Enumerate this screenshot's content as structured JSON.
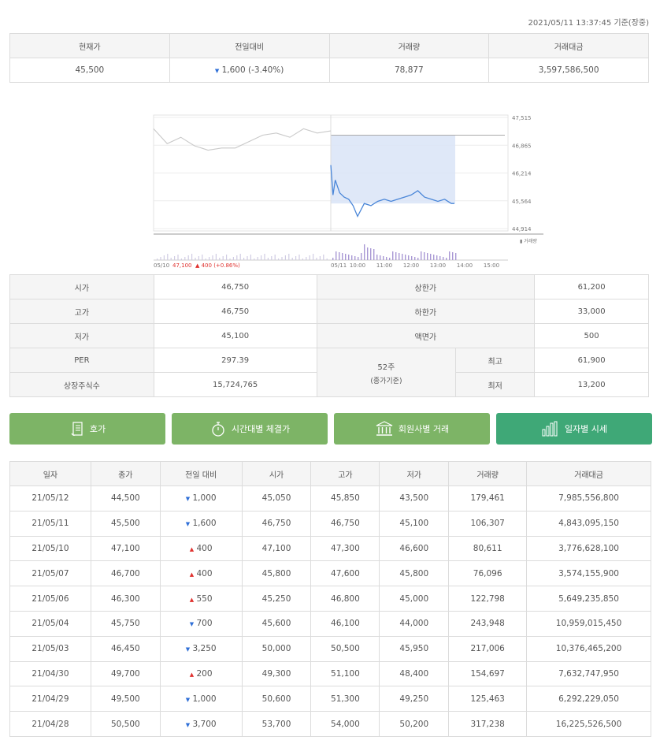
{
  "timestamp": "2021/05/11 13:37:45 기준(장중)",
  "summary": {
    "headers": [
      "현재가",
      "전일대비",
      "거래량",
      "거래대금"
    ],
    "price": "45,500",
    "change_dir": "down",
    "change": "1,600 (-3.40%)",
    "volume": "78,877",
    "amount": "3,597,586,500"
  },
  "chart_data": {
    "type": "line",
    "y_ticks": [
      "47,515",
      "46,865",
      "46,214",
      "45,564",
      "44,914"
    ],
    "ylim": [
      44914,
      47515
    ],
    "volume_legend": "거래량",
    "prev_day_label": "05/10",
    "prev_close_note": "47,100",
    "prev_change_note": "400 (+0.86%)",
    "x_ticks": [
      "05/11",
      "10:00",
      "11:00",
      "12:00",
      "13:00",
      "14:00",
      "15:00"
    ],
    "prev_day_close": 47100,
    "series": [
      {
        "x": [
          "09:00",
          "09:30",
          "10:00",
          "10:30",
          "11:00",
          "11:30",
          "12:00",
          "12:30",
          "13:00",
          "13:30",
          "14:00",
          "14:30",
          "15:00",
          "15:30"
        ],
        "values": [
          47250,
          46900,
          47050,
          46850,
          46750,
          46800,
          46800,
          46950,
          47100,
          47150,
          47050,
          47250,
          47150,
          47200
        ]
      },
      {
        "x": [
          "09:00",
          "09:05",
          "09:10",
          "09:20",
          "09:30",
          "09:40",
          "09:50",
          "10:00",
          "10:15",
          "10:30",
          "10:45",
          "11:00",
          "11:15",
          "11:30",
          "11:45",
          "12:00",
          "12:15",
          "12:30",
          "12:45",
          "13:00",
          "13:15",
          "13:30",
          "13:37"
        ],
        "values": [
          46400,
          45700,
          46050,
          45750,
          45650,
          45600,
          45450,
          45200,
          45500,
          45450,
          45550,
          45600,
          45550,
          45600,
          45650,
          45700,
          45800,
          45650,
          45600,
          45550,
          45600,
          45500,
          45500
        ]
      }
    ]
  },
  "info": {
    "open_label": "시가",
    "open": "46,750",
    "upper_label": "상한가",
    "upper": "61,200",
    "high_label": "고가",
    "high": "46,750",
    "lower_label": "하한가",
    "lower": "33,000",
    "low_label": "저가",
    "low": "45,100",
    "par_label": "액면가",
    "par": "500",
    "per_label": "PER",
    "per": "297.39",
    "week52_label": "52주",
    "week52_sub": "(종가기준)",
    "w52_high_label": "최고",
    "w52_high": "61,900",
    "shares_label": "상장주식수",
    "shares": "15,724,765",
    "w52_low_label": "최저",
    "w52_low": "13,200"
  },
  "buttons": {
    "hoga": "호가",
    "time": "시간대별 체결가",
    "member": "회원사별 거래",
    "daily": "일자별 시세"
  },
  "daily": {
    "headers": [
      "일자",
      "종가",
      "전일 대비",
      "시가",
      "고가",
      "저가",
      "거래량",
      "거래대금"
    ],
    "rows": [
      {
        "date": "21/05/12",
        "close": "44,500",
        "dir": "down",
        "diff": "1,000",
        "open": "45,050",
        "high": "45,850",
        "low": "43,500",
        "vol": "179,461",
        "amt": "7,985,556,800"
      },
      {
        "date": "21/05/11",
        "close": "45,500",
        "dir": "down",
        "diff": "1,600",
        "open": "46,750",
        "high": "46,750",
        "low": "45,100",
        "vol": "106,307",
        "amt": "4,843,095,150"
      },
      {
        "date": "21/05/10",
        "close": "47,100",
        "dir": "up",
        "diff": "400",
        "open": "47,100",
        "high": "47,300",
        "low": "46,600",
        "vol": "80,611",
        "amt": "3,776,628,100"
      },
      {
        "date": "21/05/07",
        "close": "46,700",
        "dir": "up",
        "diff": "400",
        "open": "45,800",
        "high": "47,600",
        "low": "45,800",
        "vol": "76,096",
        "amt": "3,574,155,900"
      },
      {
        "date": "21/05/06",
        "close": "46,300",
        "dir": "up",
        "diff": "550",
        "open": "45,250",
        "high": "46,800",
        "low": "45,000",
        "vol": "122,798",
        "amt": "5,649,235,850"
      },
      {
        "date": "21/05/04",
        "close": "45,750",
        "dir": "down",
        "diff": "700",
        "open": "45,600",
        "high": "46,100",
        "low": "44,000",
        "vol": "243,948",
        "amt": "10,959,015,450"
      },
      {
        "date": "21/05/03",
        "close": "46,450",
        "dir": "down",
        "diff": "3,250",
        "open": "50,000",
        "high": "50,500",
        "low": "45,950",
        "vol": "217,006",
        "amt": "10,376,465,200"
      },
      {
        "date": "21/04/30",
        "close": "49,700",
        "dir": "up",
        "diff": "200",
        "open": "49,300",
        "high": "51,100",
        "low": "48,400",
        "vol": "154,697",
        "amt": "7,632,747,950"
      },
      {
        "date": "21/04/29",
        "close": "49,500",
        "dir": "down",
        "diff": "1,000",
        "open": "50,600",
        "high": "51,300",
        "low": "49,250",
        "vol": "125,463",
        "amt": "6,292,229,050"
      },
      {
        "date": "21/04/28",
        "close": "50,500",
        "dir": "down",
        "diff": "3,700",
        "open": "53,700",
        "high": "54,000",
        "low": "50,200",
        "vol": "317,238",
        "amt": "16,225,526,500"
      }
    ]
  }
}
